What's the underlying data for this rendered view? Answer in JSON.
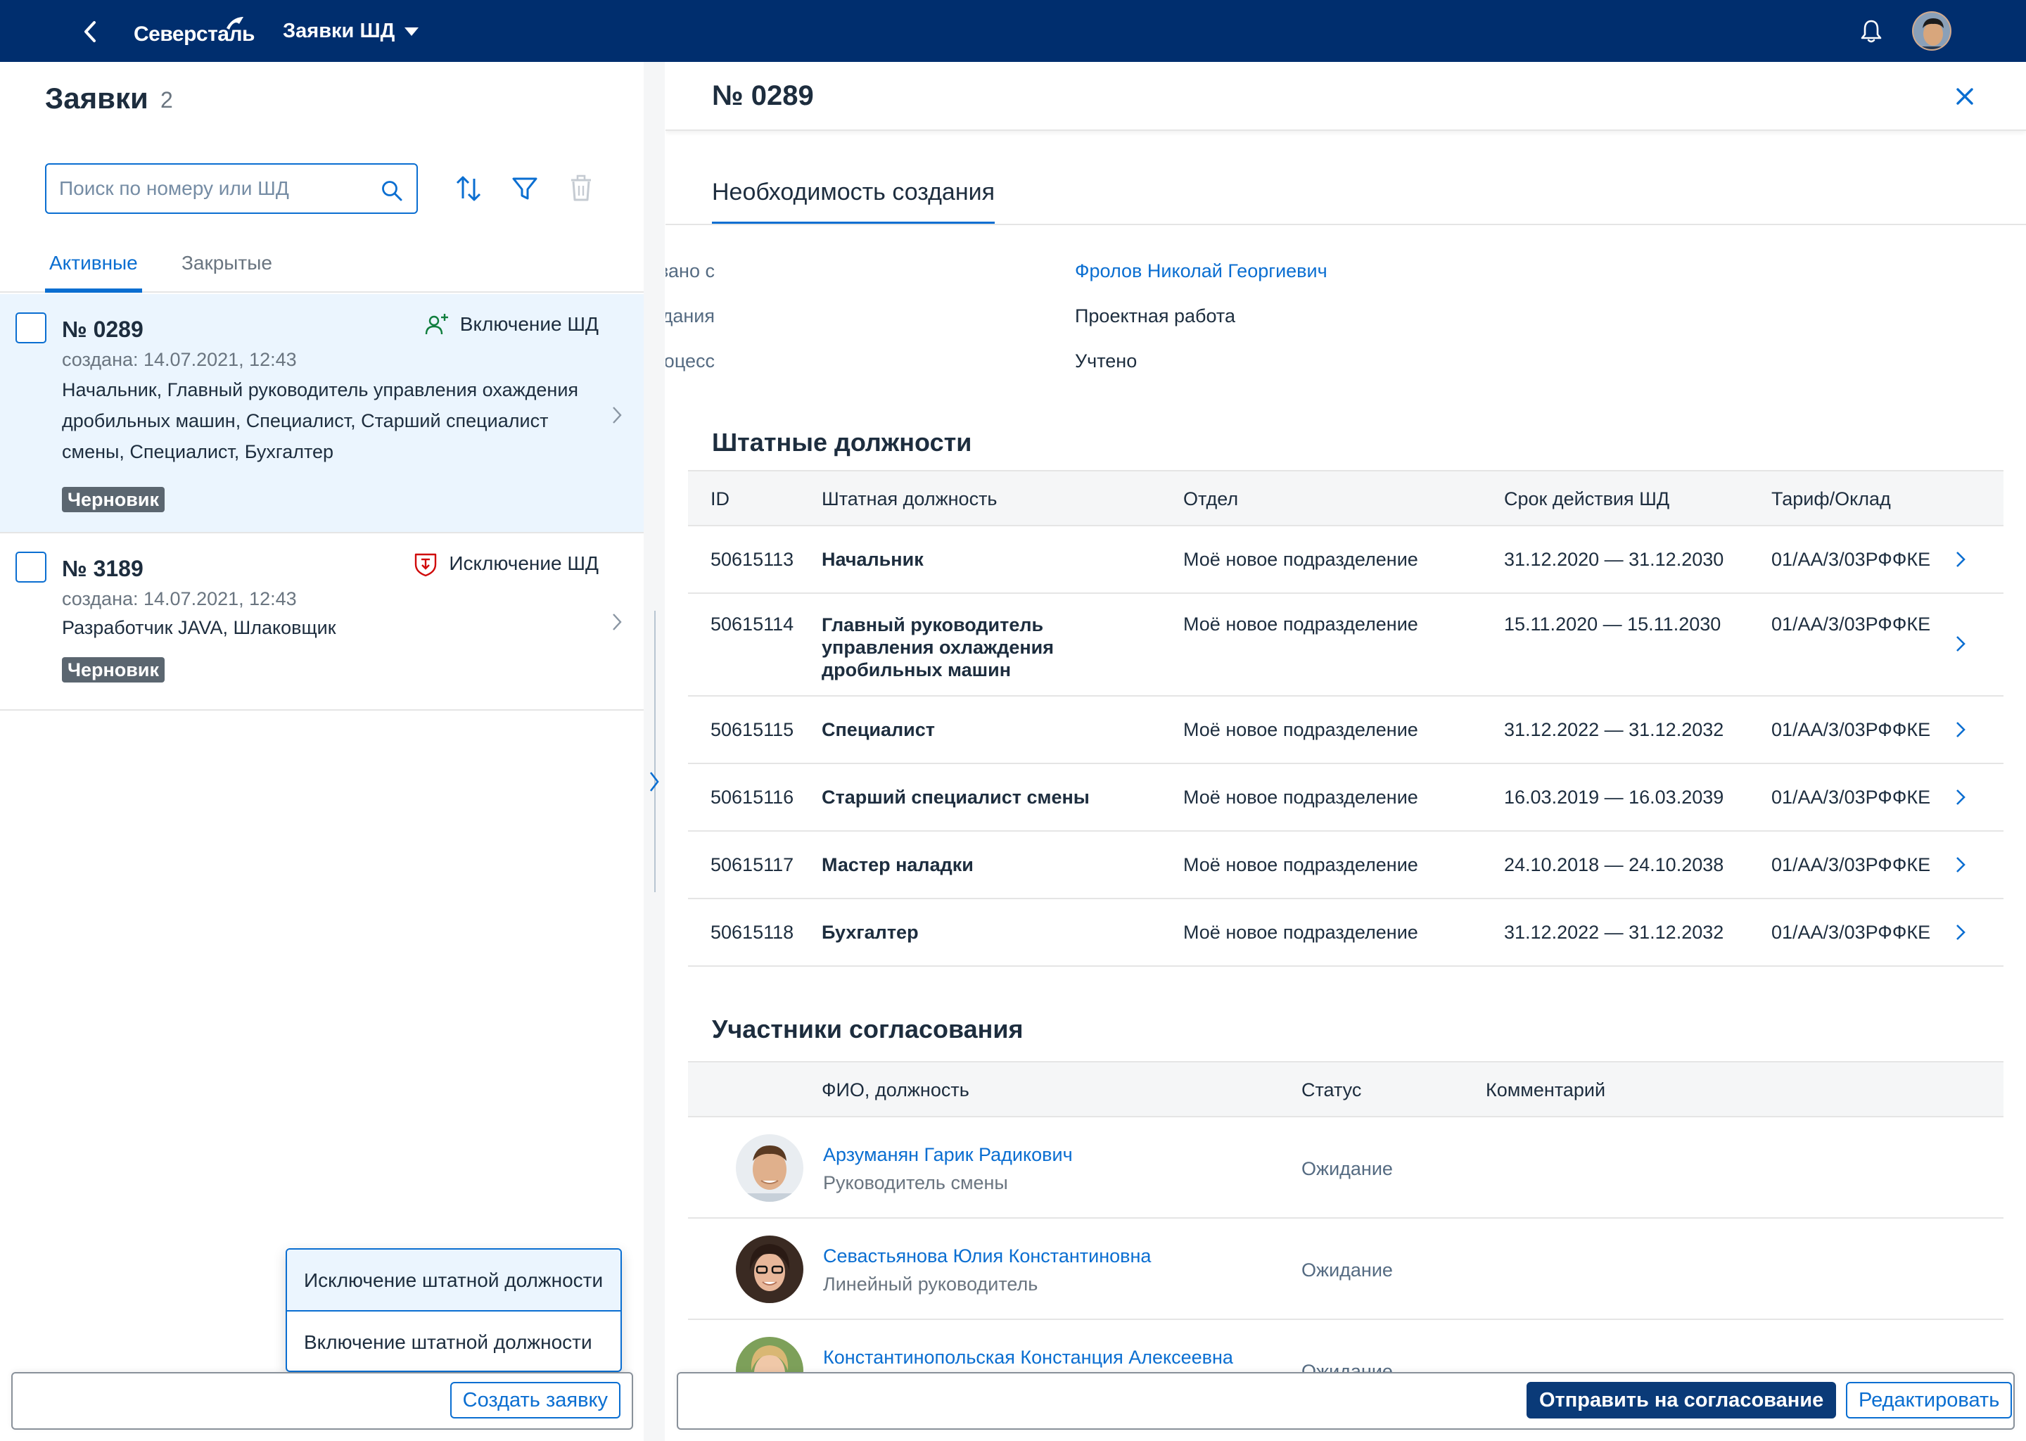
{
  "shell": {
    "logo_text": "Северсталь",
    "app_title": "Заявки ШД"
  },
  "master": {
    "title": "Заявки",
    "count": "2",
    "search_placeholder": "Поиск по номеру или ШД",
    "tabs": [
      "Активные",
      "Закрытые"
    ],
    "items": [
      {
        "number": "№ 0289",
        "created": "создана: 14.07.2021, 12:43",
        "type": "Включение ШД",
        "description": "Начальник, Главный руководитель управления охаждения дробильных машин, Специалист, Старший специалист смены, Специалист, Бухгалтер",
        "status": "Черновик",
        "type_color": "#107e3e"
      },
      {
        "number": "№ 3189",
        "created": "создана: 14.07.2021, 12:43",
        "type": "Исключение ШД",
        "description": "Разработчик JAVA, Шлаковщик",
        "status": "Черновик",
        "type_color": "#d00a0a"
      }
    ],
    "menu": [
      "Исключение штатной должности",
      "Включение штатной должности"
    ],
    "create_button": "Создать заявку"
  },
  "detail": {
    "title": "№ 0289",
    "section_tab": "Необходимость создания",
    "form": [
      {
        "label": "Согласовано с",
        "value": "Фролов Николай Георгиевич",
        "link": true
      },
      {
        "label": "Причина создания",
        "value": "Проектная работа",
        "link": false
      },
      {
        "label": "Влияние на бизнес-процесс",
        "value": "Учтено",
        "link": false
      }
    ],
    "positions": {
      "title": "Штатные должности",
      "columns": [
        "ID",
        "Штатная должность",
        "Отдел",
        "Срок действия ШД",
        "Тариф/Оклад"
      ],
      "rows": [
        {
          "id": "50615113",
          "position": "Начальник",
          "dept": "Моё новое подразделение",
          "period": "31.12.2020 — 31.12.2030",
          "tariff": "01/АА/3/03РФФКЕ"
        },
        {
          "id": "50615114",
          "position": "Главный руководитель управления охлаждения дробильных машин",
          "dept": "Моё новое подразделение",
          "period": "15.11.2020 — 15.11.2030",
          "tariff": "01/АА/3/03РФФКЕ"
        },
        {
          "id": "50615115",
          "position": "Специалист",
          "dept": "Моё новое подразделение",
          "period": "31.12.2022 — 31.12.2032",
          "tariff": "01/АА/3/03РФФКЕ"
        },
        {
          "id": "50615116",
          "position": "Старший специалист смены",
          "dept": "Моё новое подразделение",
          "period": "16.03.2019 — 16.03.2039",
          "tariff": "01/АА/3/03РФФКЕ"
        },
        {
          "id": "50615117",
          "position": "Мастер наладки",
          "dept": "Моё новое подразделение",
          "period": "24.10.2018 — 24.10.2038",
          "tariff": "01/АА/3/03РФФКЕ"
        },
        {
          "id": "50615118",
          "position": "Бухгалтер",
          "dept": "Моё новое подразделение",
          "period": "31.12.2022 — 31.12.2032",
          "tariff": "01/АА/3/03РФФКЕ"
        }
      ]
    },
    "participants": {
      "title": "Участники согласования",
      "columns": [
        "ФИО, должность",
        "Статус",
        "Комментарий"
      ],
      "rows": [
        {
          "name": "Арзуманян Гарик Радикович",
          "role": "Руководитель смены",
          "status": "Ожидание"
        },
        {
          "name": "Севастьянова Юлия Константиновна",
          "role": "Линейный руководитель",
          "status": "Ожидание"
        },
        {
          "name": "Константинопольская Констанция Алексеевна",
          "role": "",
          "status": "Ожидание"
        }
      ]
    },
    "send_button": "Отправить на согласование",
    "edit_button": "Редактировать"
  },
  "colors": {
    "shell": "#002e6e",
    "accent": "#0a6ed1",
    "selected_row": "#ebf5fe",
    "badge": "#5b6670",
    "emphasized_button": "#0a3a78"
  }
}
